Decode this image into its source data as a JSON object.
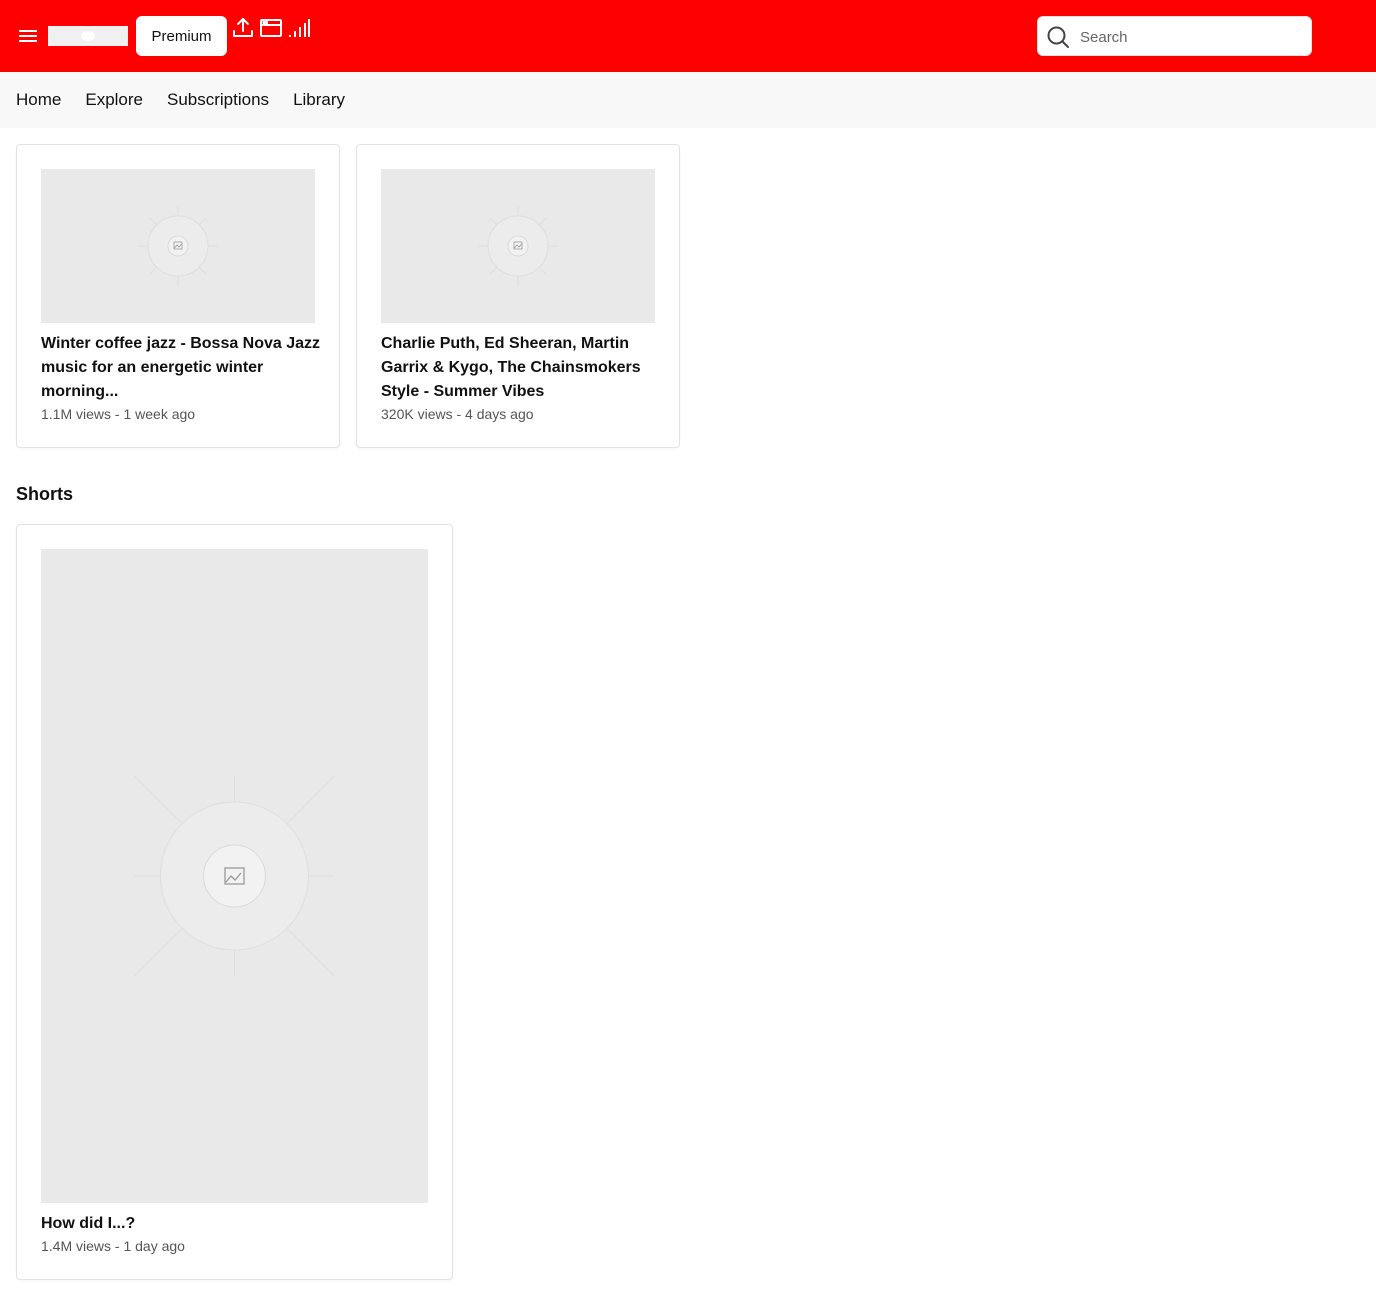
{
  "header": {
    "premium_label": "Premium",
    "search": {
      "placeholder": "Search",
      "value": ""
    },
    "colors": {
      "brand": "#ff0000",
      "nav_bg": "#f8f8f8",
      "thumb_bg": "#e9e9e9"
    },
    "icons": [
      "menu-icon",
      "upload-icon",
      "browser-window-icon",
      "signal-bars-icon",
      "search-icon"
    ]
  },
  "nav": {
    "items": [
      {
        "label": "Home"
      },
      {
        "label": "Explore"
      },
      {
        "label": "Subscriptions"
      },
      {
        "label": "Library"
      }
    ]
  },
  "videos": [
    {
      "title": "Winter coffee jazz - Bossa Nova Jazz music for an energetic winter morning...",
      "meta": "1.1M views - 1 week ago"
    },
    {
      "title": "Charlie Puth, Ed Sheeran, Martin Garrix & Kygo, The Chainsmokers Style - Summer Vibes",
      "meta": "320K views - 4 days ago"
    }
  ],
  "shorts": {
    "heading": "Shorts",
    "items": [
      {
        "title": "How did I...?",
        "meta": "1.4M views - 1 day ago"
      }
    ]
  }
}
